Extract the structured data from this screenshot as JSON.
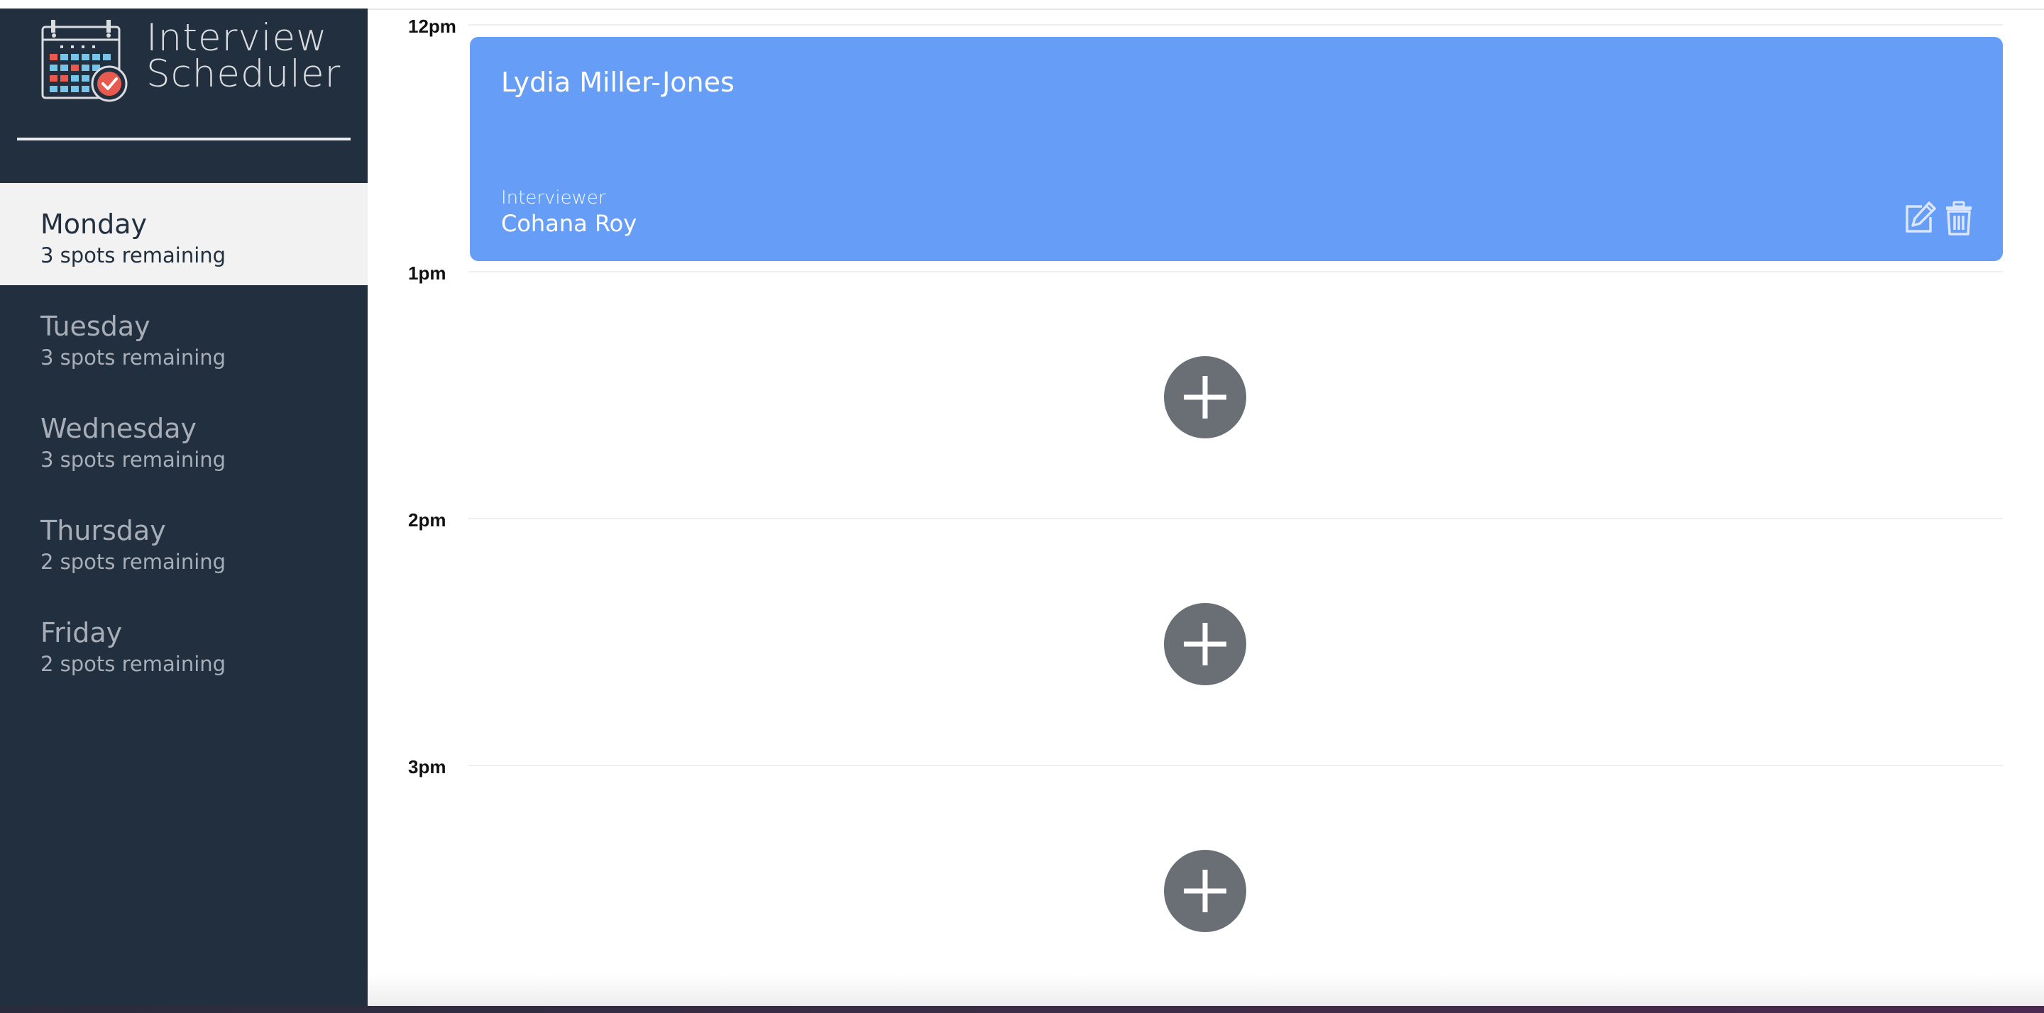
{
  "app": {
    "title_line1": "Interview",
    "title_line2": "Scheduler",
    "logo_icon": "calendar-check-icon"
  },
  "sidebar": {
    "days": [
      {
        "name": "Monday",
        "spots": "3 spots remaining",
        "selected": true
      },
      {
        "name": "Tuesday",
        "spots": "3 spots remaining",
        "selected": false
      },
      {
        "name": "Wednesday",
        "spots": "3 spots remaining",
        "selected": false
      },
      {
        "name": "Thursday",
        "spots": "2 spots remaining",
        "selected": false
      },
      {
        "name": "Friday",
        "spots": "2 spots remaining",
        "selected": false
      }
    ]
  },
  "schedule": {
    "times": [
      "12pm",
      "1pm",
      "2pm",
      "3pm"
    ],
    "appointment": {
      "student": "Lydia Miller-Jones",
      "interviewer_label": "Interviewer",
      "interviewer": "Cohana Roy",
      "edit_icon": "edit-icon",
      "delete_icon": "trash-icon"
    },
    "empty_slot_icon": "plus-icon"
  },
  "colors": {
    "sidebar_bg": "#222f3e",
    "selected_day_bg": "#f2f2f2",
    "appointment_bg": "#669df6",
    "add_button_bg": "#6a6e75"
  }
}
